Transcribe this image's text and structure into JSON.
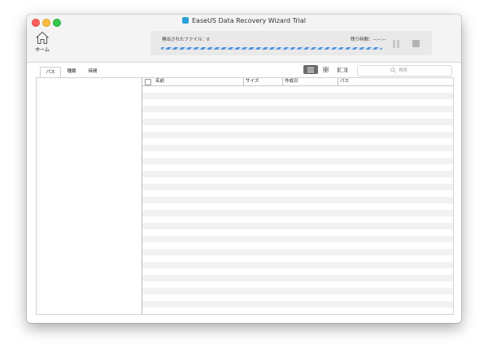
{
  "window": {
    "title": "EaseUS Data Recovery Wizard Trial"
  },
  "home": {
    "label": "ホーム",
    "icon": "home-icon"
  },
  "scan": {
    "found_label": "検出されたファイル：0",
    "remaining_label": "残り時間：--:--:--",
    "progress": 0.0
  },
  "tabs": [
    "パス",
    "種類",
    "時間"
  ],
  "search": {
    "placeholder": "検索"
  },
  "table": {
    "columns": [
      "名前",
      "サイズ",
      "作成日",
      "パス"
    ]
  },
  "colors": {
    "accent": "#4f8fd8",
    "active_view": "#6d6d6d"
  }
}
